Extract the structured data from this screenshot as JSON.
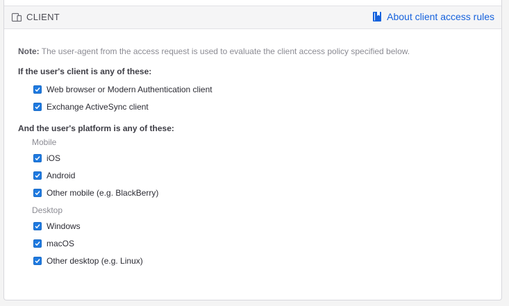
{
  "header": {
    "title": "CLIENT",
    "about_link": "About client access rules",
    "link_color": "#1662dd"
  },
  "note": {
    "label": "Note:",
    "text": "The user-agent from the access request is used to evaluate the client access policy specified below."
  },
  "clients": {
    "heading": "If the user's client is any of these:",
    "options": [
      {
        "label": "Web browser or Modern Authentication client",
        "checked": true
      },
      {
        "label": "Exchange ActiveSync client",
        "checked": true
      }
    ]
  },
  "platforms": {
    "heading": "And the user's platform is any of these:",
    "mobile": {
      "label": "Mobile",
      "options": [
        {
          "label": "iOS",
          "checked": true
        },
        {
          "label": "Android",
          "checked": true
        },
        {
          "label": "Other mobile (e.g. BlackBerry)",
          "checked": true
        }
      ]
    },
    "desktop": {
      "label": "Desktop",
      "options": [
        {
          "label": "Windows",
          "checked": true
        },
        {
          "label": "macOS",
          "checked": true
        },
        {
          "label": "Other desktop (e.g. Linux)",
          "checked": true
        }
      ]
    }
  },
  "colors": {
    "checkbox": "#1f7ae0"
  }
}
